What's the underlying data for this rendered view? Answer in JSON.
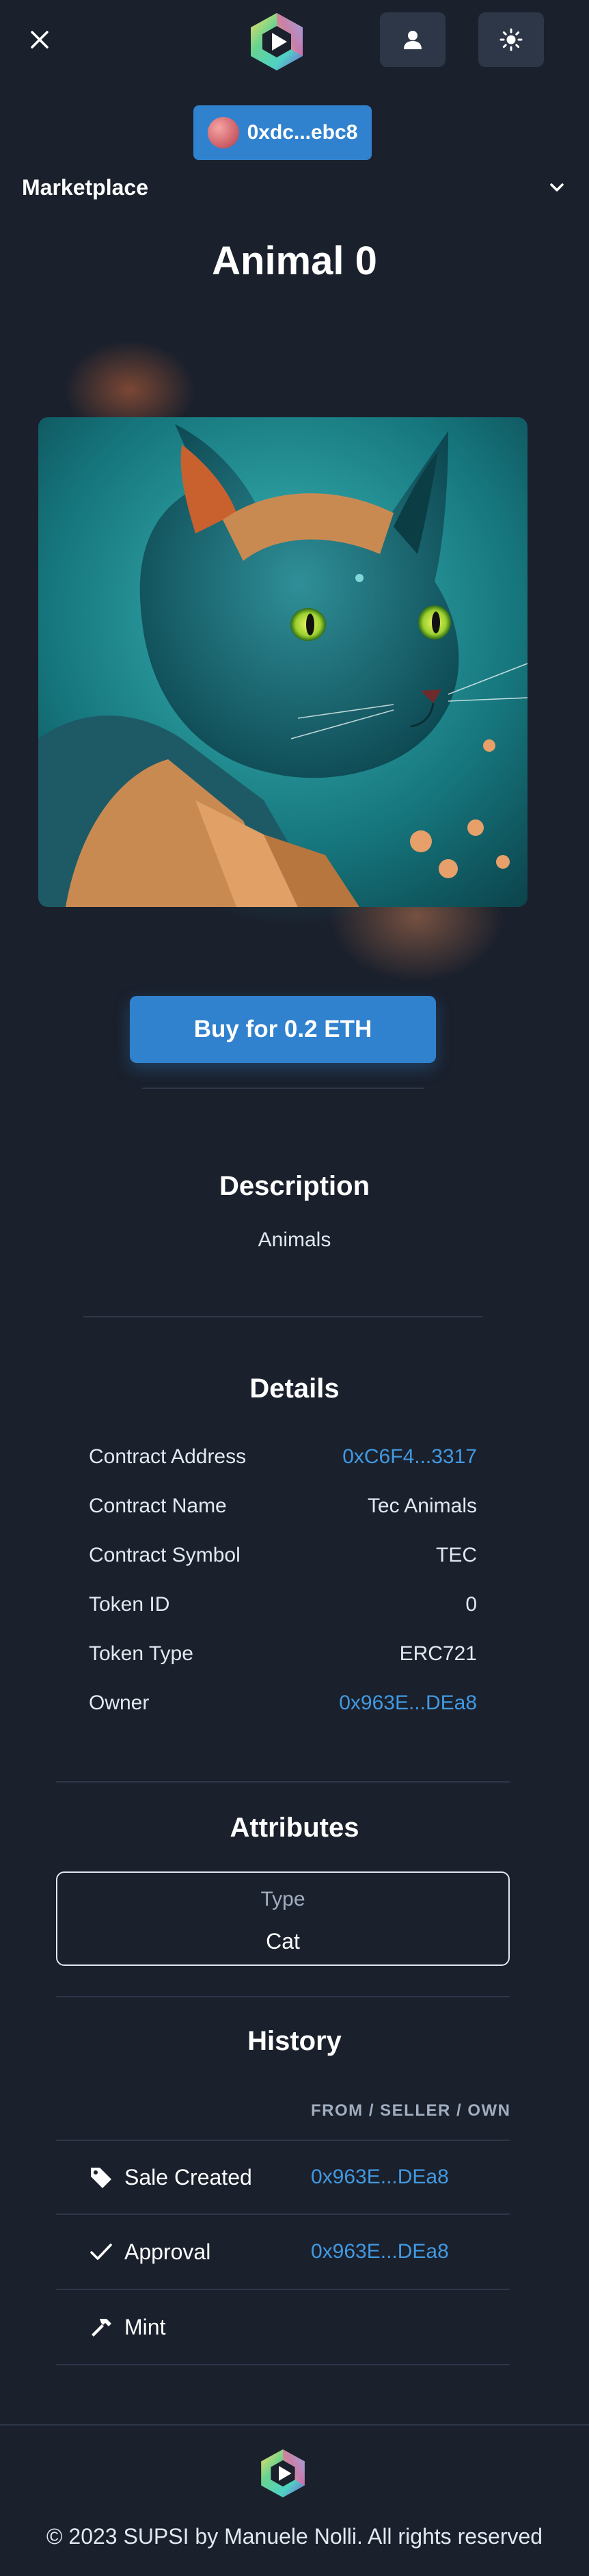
{
  "header": {
    "close_icon": "close-icon",
    "logo_icon": "hexagon-play-logo",
    "profile_icon": "user-icon",
    "theme_icon": "sun-icon",
    "wallet_address": "0xdc...ebc8",
    "accent": "#3182ce"
  },
  "nav": {
    "marketplace_label": "Marketplace",
    "chevron_icon": "chevron-down-icon"
  },
  "nft": {
    "title": "Animal 0",
    "buy_label": "Buy for 0.2 ETH"
  },
  "description": {
    "title": "Description",
    "text": "Animals"
  },
  "details": {
    "title": "Details",
    "rows": [
      {
        "label": "Contract Address",
        "value": "0xC6F4...3317"
      },
      {
        "label": "Contract Name",
        "value": "Tec Animals"
      },
      {
        "label": "Contract Symbol",
        "value": "TEC"
      },
      {
        "label": "Token ID",
        "value": "0"
      },
      {
        "label": "Token Type",
        "value": "ERC721"
      },
      {
        "label": "Owner",
        "value": "0x963E...DEa8"
      }
    ]
  },
  "attributes": {
    "title": "Attributes",
    "items": [
      {
        "type": "Type",
        "value": "Cat"
      }
    ]
  },
  "history": {
    "title": "History",
    "column_header": "FROM / SELLER / OWNER",
    "rows": [
      {
        "event": "Sale Created",
        "icon": "tag-icon",
        "from": "0x963E...DEa8"
      },
      {
        "event": "Approval",
        "icon": "check-icon",
        "from": "0x963E...DEa8"
      },
      {
        "event": "Mint",
        "icon": "hammer-icon",
        "from": ""
      }
    ]
  },
  "footer": {
    "copyright": "© 2023 SUPSI by Manuele Nolli. All rights reserved"
  }
}
